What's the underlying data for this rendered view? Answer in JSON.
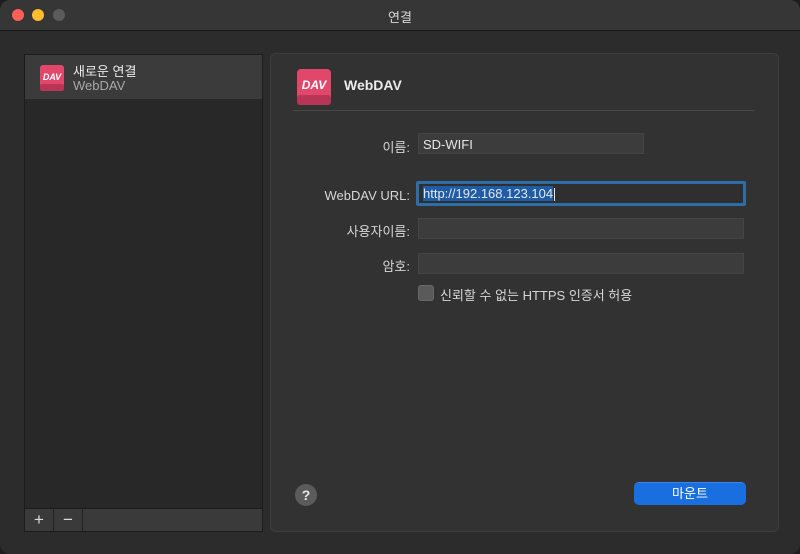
{
  "window": {
    "title": "연결"
  },
  "sidebar": {
    "items": [
      {
        "name": "새로운 연결",
        "type": "WebDAV",
        "selected": true
      }
    ],
    "add_label": "+",
    "remove_label": "−"
  },
  "panel": {
    "title": "WebDAV",
    "fields": {
      "name_label": "이름:",
      "name_value": "SD-WIFI",
      "url_label": "WebDAV URL:",
      "url_value": "http://192.168.123.104",
      "username_label": "사용자이름:",
      "username_value": "",
      "password_label": "암호:",
      "password_value": ""
    },
    "https_checkbox": {
      "label": "신뢰할 수 없는 HTTPS 인증서 허용",
      "checked": false
    },
    "help_label": "?",
    "mount_label": "마운트"
  },
  "colors": {
    "accent": "#1a6fe0",
    "focus_ring": "#2e6ea6",
    "dav_icon": "#e0476b"
  },
  "icons": {
    "connection": "webdav-disk-icon"
  }
}
